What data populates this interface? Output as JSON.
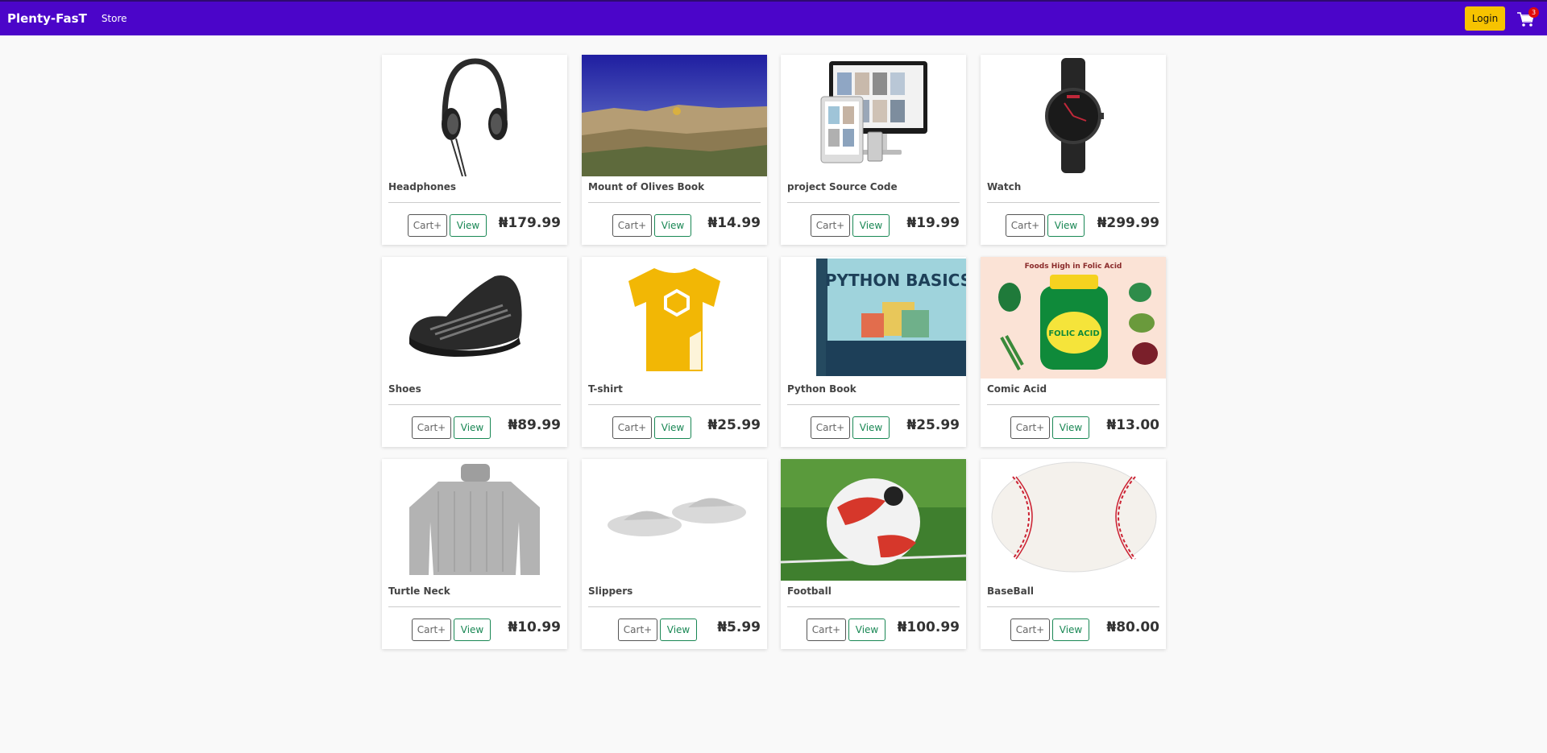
{
  "navbar": {
    "brand": "Plenty-FasT",
    "store_link": "Store",
    "login_label": "Login",
    "cart_count": "3",
    "bg_color": "#4b05c9",
    "login_color": "#f7c300"
  },
  "products": [
    {
      "name": "Headphones",
      "price": "₦179.99",
      "cart_label": "Cart+",
      "view_label": "View",
      "image": "headphones"
    },
    {
      "name": "Mount of Olives Book",
      "price": "₦14.99",
      "cart_label": "Cart+",
      "view_label": "View",
      "image": "city-landscape"
    },
    {
      "name": "project Source Code",
      "price": "₦19.99",
      "cart_label": "Cart+",
      "view_label": "View",
      "image": "website-mockup"
    },
    {
      "name": "Watch",
      "price": "₦299.99",
      "cart_label": "Cart+",
      "view_label": "View",
      "image": "wristwatch"
    },
    {
      "name": "Shoes",
      "price": "₦89.99",
      "cart_label": "Cart+",
      "view_label": "View",
      "image": "sneaker"
    },
    {
      "name": "T-shirt",
      "price": "₦25.99",
      "cart_label": "Cart+",
      "view_label": "View",
      "image": "yellow-tshirt"
    },
    {
      "name": "Python Book",
      "price": "₦25.99",
      "cart_label": "Cart+",
      "view_label": "View",
      "image": "python-book",
      "cover_title": "PYTHON BASICS"
    },
    {
      "name": "Comic Acid",
      "price": "₦13.00",
      "cart_label": "Cart+",
      "view_label": "View",
      "image": "folic-acid-poster",
      "poster_title": "Foods High in Folic Acid",
      "jar_label": "FOLIC ACID"
    },
    {
      "name": "Turtle Neck",
      "price": "₦10.99",
      "cart_label": "Cart+",
      "view_label": "View",
      "image": "sweater"
    },
    {
      "name": "Slippers",
      "price": "₦5.99",
      "cart_label": "Cart+",
      "view_label": "View",
      "image": "slippers"
    },
    {
      "name": "Football",
      "price": "₦100.99",
      "cart_label": "Cart+",
      "view_label": "View",
      "image": "football"
    },
    {
      "name": "BaseBall",
      "price": "₦80.00",
      "cart_label": "Cart+",
      "view_label": "View",
      "image": "baseball"
    }
  ]
}
